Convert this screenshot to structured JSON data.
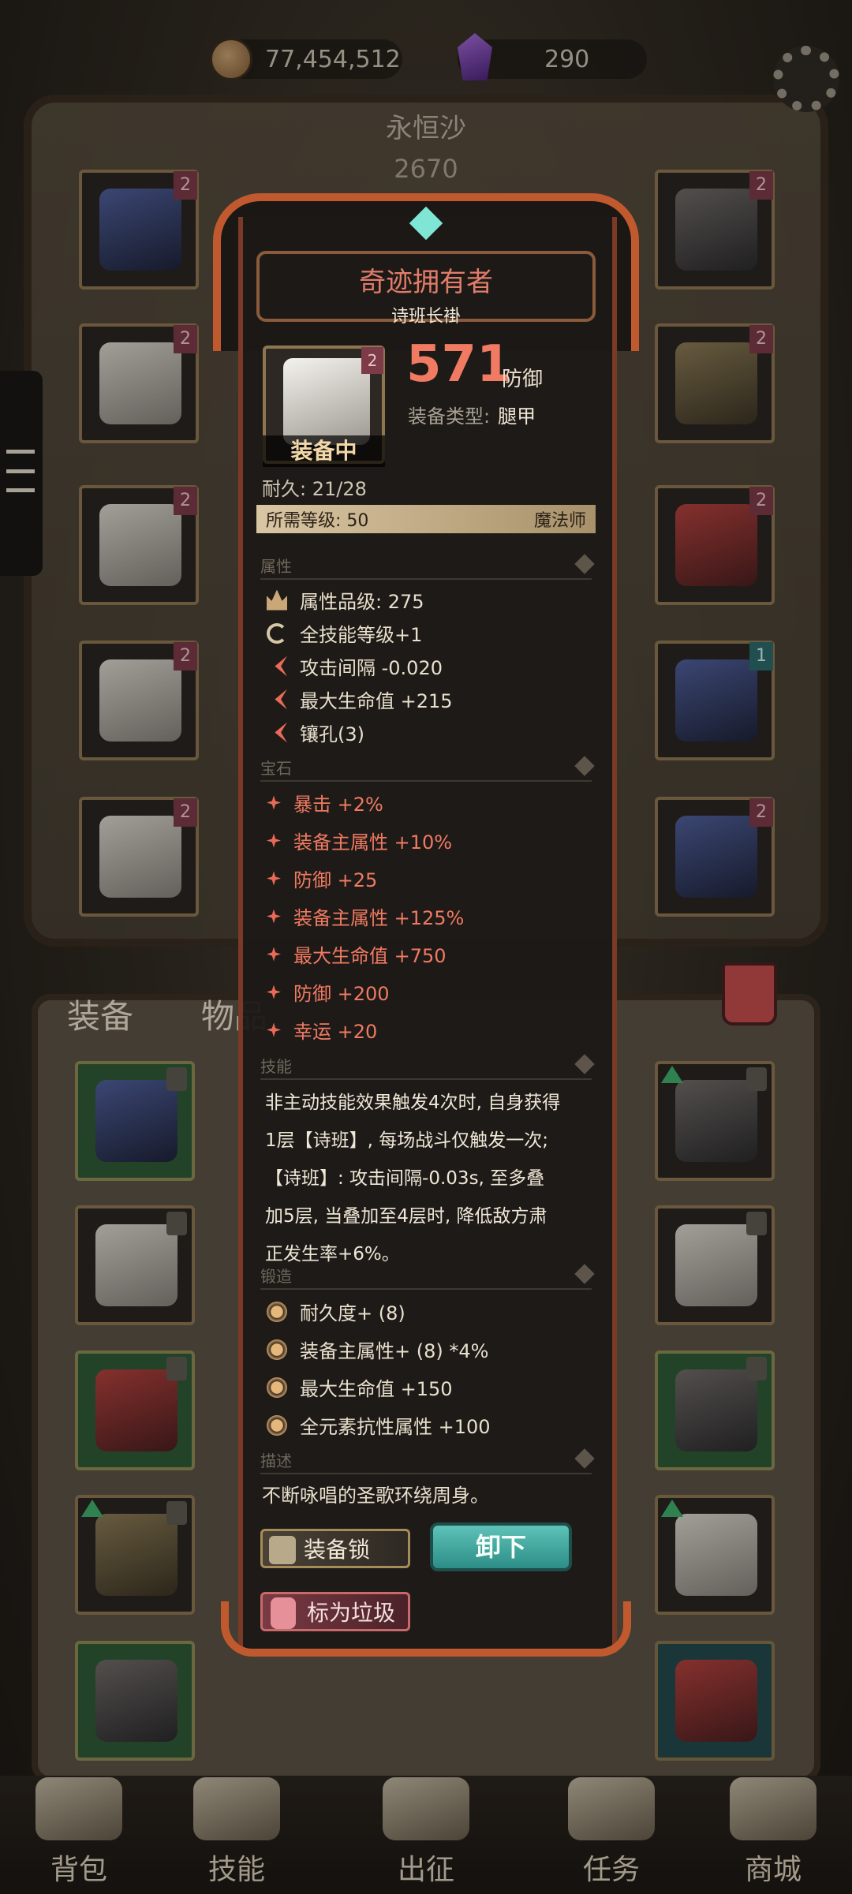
{
  "currency": {
    "gold": "77,454,512",
    "gems": "290"
  },
  "hero": {
    "name": "永恒沙",
    "power": "2670"
  },
  "tooltip": {
    "title": "奇迹拥有者",
    "item_name": "诗班长褂",
    "item_level": "2",
    "equipped_label": "装备中",
    "defense_value": "571",
    "defense_label": "防御",
    "type_label": "装备类型:",
    "type_value": "腿甲",
    "durability": "耐久: 21/28",
    "req_level": "所需等级: 50",
    "req_class": "魔法师",
    "sections": {
      "attributes": "属性",
      "gems": "宝石",
      "skills": "技能",
      "forge": "锻造",
      "description": "描述"
    },
    "attributes": [
      {
        "icon": "crown-icon",
        "text": "属性品级: 275"
      },
      {
        "icon": "cycle-icon",
        "text": "全技能等级+1"
      },
      {
        "icon": "arrow-icon",
        "text": "攻击间隔 -0.020"
      },
      {
        "icon": "arrow-icon",
        "text": "最大生命值 +215"
      },
      {
        "icon": "arrow-icon",
        "text": "镶孔(3)"
      }
    ],
    "gems": [
      "暴击 +2%",
      "装备主属性 +10%",
      "防御 +25",
      "装备主属性 +125%",
      "最大生命值 +750",
      "防御 +200",
      "幸运 +20"
    ],
    "skill_lines": [
      "非主动技能效果触发4次时, 自身获得",
      "1层【诗班】, 每场战斗仅触发一次;",
      "【诗班】: 攻击间隔-0.03s, 至多叠",
      "加5层, 当叠加至4层时, 降低敌方肃",
      "正发生率+6%。"
    ],
    "forge": [
      "耐久度+ (8)",
      "装备主属性+ (8) *4%",
      "最大生命值 +150",
      "全元素抗性属性 +100"
    ],
    "description": "不断咏唱的圣歌环绕周身。",
    "btn_lock": "装备锁",
    "btn_unequip": "卸下",
    "btn_junk": "标为垃圾"
  },
  "inventory_tabs": {
    "equip": "装备",
    "items": "物品"
  },
  "nav": [
    "背包",
    "技能",
    "出征",
    "任务",
    "商城"
  ],
  "colors": {
    "accent_red": "#f07a62",
    "teal_button": "#2c8e87",
    "frame_orange": "#c05a2e"
  }
}
